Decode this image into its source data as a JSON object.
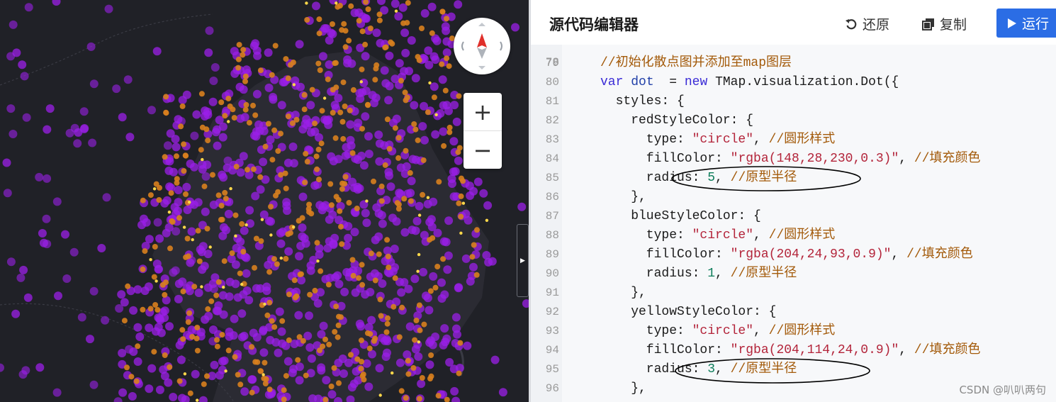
{
  "editor": {
    "title": "源代码编辑器",
    "restore_label": "还原",
    "copy_label": "复制",
    "run_label": "运行"
  },
  "map": {
    "zoom_in": "+",
    "zoom_out": "−",
    "dot_colors": {
      "purple": "#9b1fe8",
      "orange": "#d8801e",
      "yellow": "#ffd84a"
    }
  },
  "code": {
    "first_partial_line": "78",
    "lines": [
      {
        "n": "79",
        "segs": [
          [
            "cm",
            "//初始化散点图并添加至map图层"
          ]
        ]
      },
      {
        "n": "80",
        "segs": [
          [
            "kw",
            "var "
          ],
          [
            "vr",
            "dot"
          ],
          [
            "",
            "  = "
          ],
          [
            "kw",
            "new "
          ],
          [
            "",
            "TMap.visualization.Dot({"
          ]
        ]
      },
      {
        "n": "81",
        "segs": [
          [
            "",
            "  styles: {"
          ]
        ]
      },
      {
        "n": "82",
        "segs": [
          [
            "",
            "    redStyleColor: {"
          ]
        ]
      },
      {
        "n": "83",
        "segs": [
          [
            "",
            "      type: "
          ],
          [
            "st",
            "\"circle\""
          ],
          [
            "",
            ", "
          ],
          [
            "cm",
            "//圆形样式"
          ]
        ]
      },
      {
        "n": "84",
        "segs": [
          [
            "",
            "      fillColor: "
          ],
          [
            "st",
            "\"rgba(148,28,230,0.3)\""
          ],
          [
            "",
            ", "
          ],
          [
            "cm",
            "//填充颜色"
          ]
        ]
      },
      {
        "n": "85",
        "segs": [
          [
            "",
            "      radius: "
          ],
          [
            "nm",
            "5"
          ],
          [
            "",
            ", "
          ],
          [
            "cm",
            "//原型半径"
          ]
        ]
      },
      {
        "n": "86",
        "segs": [
          [
            "",
            "    },"
          ]
        ]
      },
      {
        "n": "87",
        "segs": [
          [
            "",
            "    blueStyleColor: {"
          ]
        ]
      },
      {
        "n": "88",
        "segs": [
          [
            "",
            "      type: "
          ],
          [
            "st",
            "\"circle\""
          ],
          [
            "",
            ", "
          ],
          [
            "cm",
            "//圆形样式"
          ]
        ]
      },
      {
        "n": "89",
        "segs": [
          [
            "",
            "      fillColor: "
          ],
          [
            "st",
            "\"rgba(204,24,93,0.9)\""
          ],
          [
            "",
            ", "
          ],
          [
            "cm",
            "//填充颜色"
          ]
        ]
      },
      {
        "n": "90",
        "segs": [
          [
            "",
            "      radius: "
          ],
          [
            "nm",
            "1"
          ],
          [
            "",
            ", "
          ],
          [
            "cm",
            "//原型半径"
          ]
        ]
      },
      {
        "n": "91",
        "segs": [
          [
            "",
            "    },"
          ]
        ]
      },
      {
        "n": "92",
        "segs": [
          [
            "",
            "    yellowStyleColor: {"
          ]
        ]
      },
      {
        "n": "93",
        "segs": [
          [
            "",
            "      type: "
          ],
          [
            "st",
            "\"circle\""
          ],
          [
            "",
            ", "
          ],
          [
            "cm",
            "//圆形样式"
          ]
        ]
      },
      {
        "n": "94",
        "segs": [
          [
            "",
            "      fillColor: "
          ],
          [
            "st",
            "\"rgba(204,114,24,0.9)\""
          ],
          [
            "",
            ", "
          ],
          [
            "cm",
            "//填充颜色"
          ]
        ]
      },
      {
        "n": "95",
        "segs": [
          [
            "",
            "      radius: "
          ],
          [
            "nm",
            "3"
          ],
          [
            "",
            ", "
          ],
          [
            "cm",
            "//原型半径"
          ]
        ]
      },
      {
        "n": "96",
        "segs": [
          [
            "",
            "    },"
          ]
        ]
      }
    ]
  },
  "watermark": "CSDN @叭叭两句"
}
